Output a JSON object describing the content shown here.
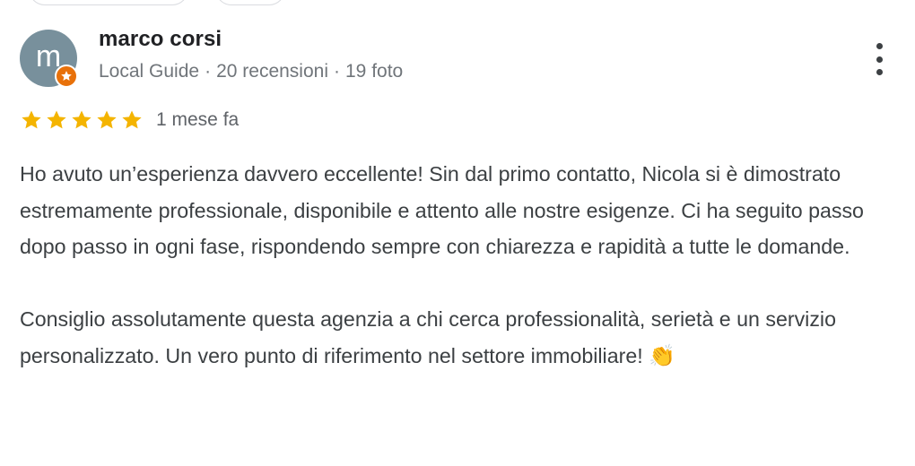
{
  "author": {
    "avatar_letter": "m",
    "name": "marco corsi",
    "role": "Local Guide",
    "reviews_count": "20 recensioni",
    "photos_count": "19 foto",
    "separator": "·"
  },
  "rating": {
    "stars": 5,
    "max_stars": 5,
    "date": "1 mese fa"
  },
  "review": {
    "paragraph_1": "Ho avuto un’esperienza davvero eccellente! Sin dal primo contatto, Nicola si è dimostrato estremamente professionale, disponibile e attento alle nostre esigenze. Ci ha seguito passo dopo passo in ogni fase, rispondendo sempre con chiarezza e rapidità a tutte le domande.",
    "paragraph_2": "Consiglio assolutamente questa agenzia a chi cerca professionalità, serietà e un servizio personalizzato. Un vero punto di riferimento nel settore immobiliare!",
    "emoji": "👏"
  },
  "icons": {
    "menu": "more-vert-icon",
    "badge": "local-guide-star-icon",
    "star": "star-icon"
  },
  "colors": {
    "star": "#f4b400",
    "badge": "#e8710a",
    "avatar": "#78909c"
  }
}
